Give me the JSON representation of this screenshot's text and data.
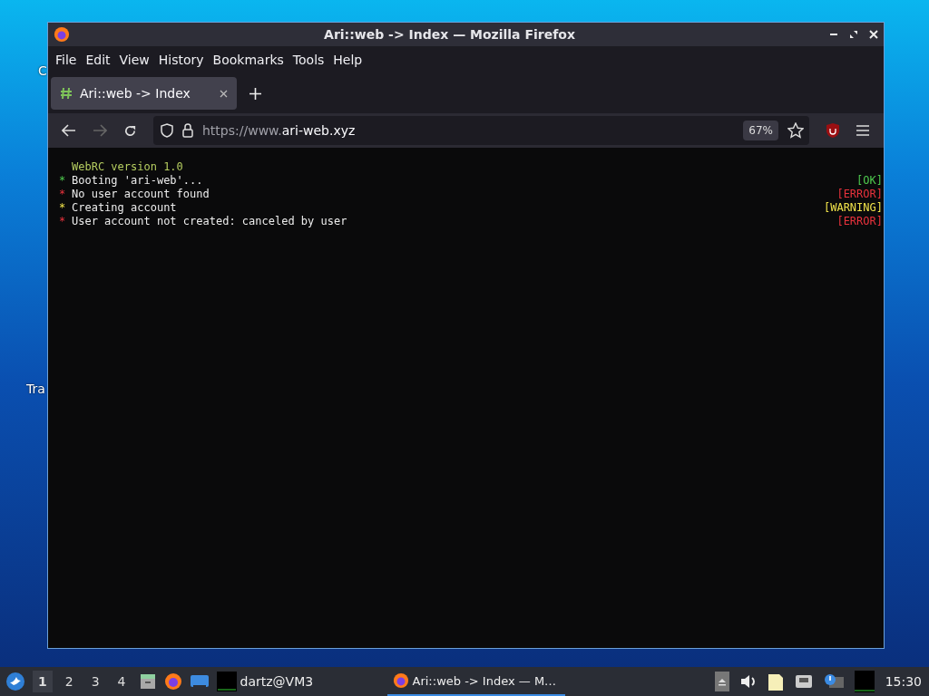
{
  "desktop_icons": [
    "C",
    "Tra"
  ],
  "window": {
    "title": "Ari::web -> Index — Mozilla Firefox"
  },
  "menu": [
    "File",
    "Edit",
    "View",
    "History",
    "Bookmarks",
    "Tools",
    "Help"
  ],
  "tabs": [
    {
      "label": "Ari::web -> Index",
      "selected": true
    }
  ],
  "address_bar": {
    "url_prefix": "https://www.",
    "url_domain": "ari-web.xyz",
    "zoom": "67%"
  },
  "terminal": {
    "header": "WebRC version 1.0",
    "lines": [
      {
        "bullet": "*",
        "text": "Booting 'ari-web'...",
        "status": "[OK]",
        "kind": "ok"
      },
      {
        "bullet": "*",
        "text": "No user account found",
        "status": "[ERROR]",
        "kind": "error"
      },
      {
        "bullet": "*",
        "text": "Creating account",
        "status": "[WARNING]",
        "kind": "warning"
      },
      {
        "bullet": "*",
        "text": "User account not created: canceled by user",
        "status": "[ERROR]",
        "kind": "error"
      }
    ]
  },
  "taskbar": {
    "workspaces": [
      {
        "label": "1",
        "selected": true
      },
      {
        "label": "2",
        "selected": false
      },
      {
        "label": "3",
        "selected": false
      },
      {
        "label": "4",
        "selected": false
      }
    ],
    "terminal_task": "dartz@VM3",
    "tasks": [
      {
        "label": "Ari::web -> Index — M…",
        "selected": true
      }
    ],
    "clock": "15:30"
  }
}
